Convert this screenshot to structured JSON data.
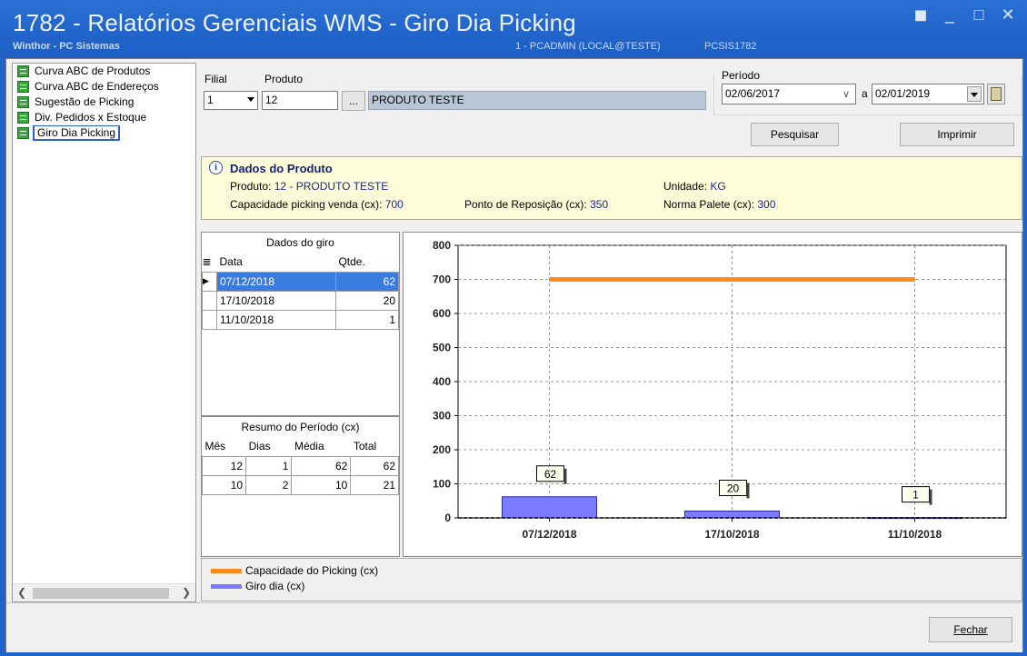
{
  "window": {
    "title": "1782 - Relatórios Gerenciais WMS - Giro Dia Picking",
    "company": "Winthor - PC Sistemas",
    "user": "1 - PCADMIN (LOCAL@TESTE)",
    "program": "PCSIS1782"
  },
  "sidebar": {
    "items": [
      {
        "label": "Curva ABC de Produtos"
      },
      {
        "label": "Curva ABC de Endereços"
      },
      {
        "label": "Sugestão de Picking"
      },
      {
        "label": "Div. Pedidos x Estoque"
      },
      {
        "label": "Giro Dia Picking"
      }
    ]
  },
  "filters": {
    "filial_label": "Filial",
    "filial_value": "1",
    "produto_label": "Produto",
    "produto_code": "12",
    "browse_label": "...",
    "produto_name": "PRODUTO TESTE",
    "periodo_label": "Período",
    "date_from": "02/06/2017",
    "date_sep": "a",
    "date_to": "02/01/2019",
    "search_button": "Pesquisar",
    "print_button": "Imprimir"
  },
  "product_info": {
    "title": "Dados do Produto",
    "produto_label": "Produto:",
    "produto_value": "12 - PRODUTO TESTE",
    "unidade_label": "Unidade:",
    "unidade_value": "KG",
    "capacidade_label": "Capacidade picking venda (cx):",
    "capacidade_value": "700",
    "reposicao_label": "Ponto de Reposição (cx):",
    "reposicao_value": "350",
    "palete_label": "Norma Palete (cx):",
    "palete_value": "300"
  },
  "giro_grid": {
    "title": "Dados do giro",
    "headers": [
      "Data",
      "Qtde."
    ],
    "rows": [
      {
        "date": "07/12/2018",
        "qty": "62"
      },
      {
        "date": "17/10/2018",
        "qty": "20"
      },
      {
        "date": "11/10/2018",
        "qty": "1"
      }
    ]
  },
  "resumo_grid": {
    "title": "Resumo do Período (cx)",
    "headers": [
      "Mês",
      "Dias",
      "Média",
      "Total"
    ],
    "rows": [
      {
        "mes": "12",
        "dias": "1",
        "media": "62",
        "total": "62"
      },
      {
        "mes": "10",
        "dias": "2",
        "media": "10",
        "total": "21"
      }
    ]
  },
  "chart_data": {
    "type": "bar",
    "categories": [
      "07/12/2018",
      "17/10/2018",
      "11/10/2018"
    ],
    "series": [
      {
        "name": "Giro dia (cx)",
        "type": "bar",
        "values": [
          62,
          20,
          1
        ],
        "color": "#7b7bff"
      },
      {
        "name": "Capacidade do Picking (cx)",
        "type": "line",
        "values": [
          700,
          700,
          700
        ],
        "color": "#ff8c1a"
      }
    ],
    "ylim": [
      0,
      800
    ],
    "yticks": [
      0,
      100,
      200,
      300,
      400,
      500,
      600,
      700,
      800
    ],
    "grid": true,
    "legend": "bottom"
  },
  "footer": {
    "close_button": "Fechar"
  }
}
